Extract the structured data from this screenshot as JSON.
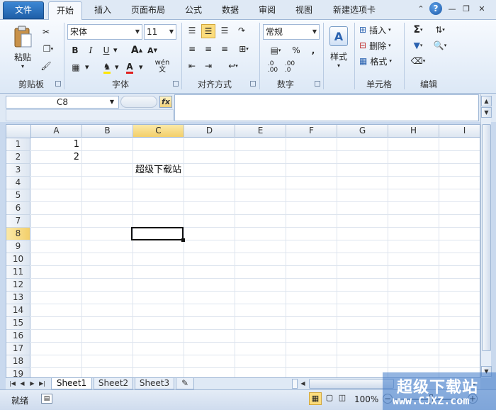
{
  "tabs": {
    "file": "文件",
    "items": [
      "开始",
      "插入",
      "页面布局",
      "公式",
      "数据",
      "审阅",
      "视图",
      "新建选项卡"
    ],
    "active": "开始"
  },
  "ribbon": {
    "clipboard": {
      "paste": "粘贴",
      "label": "剪贴板"
    },
    "font": {
      "name": "宋体",
      "size": "11",
      "label": "字体",
      "bold": "B",
      "italic": "I",
      "underline": "U",
      "grow": "A",
      "shrink": "A",
      "phonetic": "wén"
    },
    "align": {
      "label": "对齐方式"
    },
    "number": {
      "format": "常规",
      "label": "数字",
      "percent": "%",
      "comma": ",",
      "inc": ".0→.00",
      "dec": ".00→.0"
    },
    "styles": {
      "label": "样式"
    },
    "cells": {
      "insert": "插入",
      "delete": "删除",
      "format": "格式",
      "label": "单元格"
    },
    "editing": {
      "label": "编辑",
      "sum": "Σ"
    }
  },
  "formula_bar": {
    "name_box": "C8",
    "fx": "fx",
    "content": ""
  },
  "columns": [
    "A",
    "B",
    "C",
    "D",
    "E",
    "F",
    "G",
    "H",
    "I"
  ],
  "selected_column": "C",
  "rows": [
    "1",
    "2",
    "3",
    "4",
    "5",
    "6",
    "7",
    "8",
    "9",
    "10",
    "11",
    "12",
    "13",
    "14",
    "15",
    "16",
    "17",
    "18",
    "19"
  ],
  "selected_row": "8",
  "cells": {
    "A1": "1",
    "A2": "2",
    "C3": "超级下载站"
  },
  "sheets": [
    "Sheet1",
    "Sheet2",
    "Sheet3"
  ],
  "active_sheet": "Sheet1",
  "status": {
    "ready": "就绪",
    "zoom": "100%"
  },
  "watermark": {
    "title": "超级下载站",
    "url": "www.CJXZ.com"
  },
  "colors": {
    "accent": "#1f5fa8",
    "selection_header": "#f3cf6a"
  }
}
